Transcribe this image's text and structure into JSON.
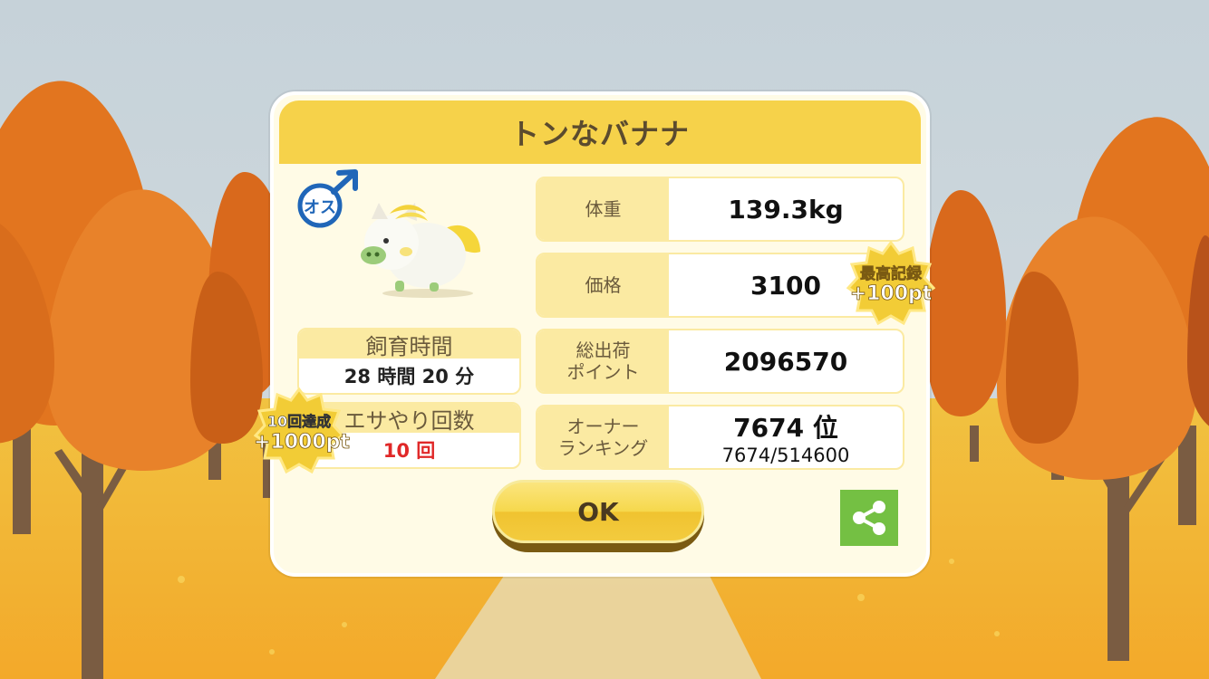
{
  "dialog": {
    "title": "トンなバナナ",
    "gender_label": "オス"
  },
  "stats": {
    "rearing_time_label": "飼育時間",
    "rearing_time_value": "28 時間 20 分",
    "feeding_count_label": "エサやり回数",
    "feeding_count_value": "10 回"
  },
  "details": [
    {
      "label": "体重",
      "value": "139.3kg"
    },
    {
      "label": "価格",
      "value": "3100"
    },
    {
      "label": "総出荷\nポイント",
      "value": "2096570"
    },
    {
      "label": "オーナー\nランキング",
      "value": "7674 位",
      "sub": "7674/514600"
    }
  ],
  "badges": {
    "best_record_line1": "最高記録",
    "best_record_line2": "+100pt",
    "achievement_line1": "10回達成",
    "achievement_line2": "+1000pt"
  },
  "buttons": {
    "ok_label": "OK",
    "share_icon": "share-icon"
  },
  "colors": {
    "header_yellow": "#f6d24a",
    "label_bg": "#fbeaa2",
    "share_green": "#74c043",
    "accent_red": "#e02828"
  }
}
